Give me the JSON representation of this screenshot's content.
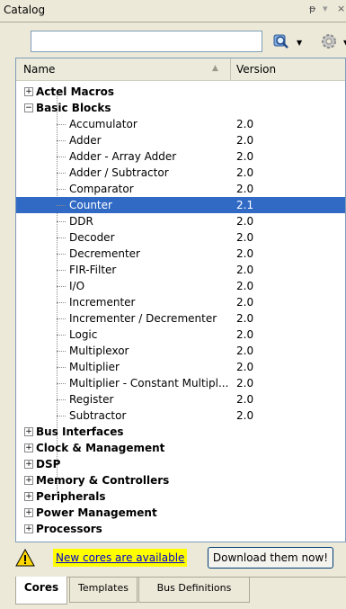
{
  "window": {
    "title": "Catalog",
    "pin_glyph": "ᵽ",
    "menu_glyph": "▾",
    "close_glyph": "×"
  },
  "search": {
    "value": "",
    "placeholder": ""
  },
  "columns": {
    "name": "Name",
    "version": "Version"
  },
  "categories_before": [
    {
      "label": "Actel Macros",
      "expanded": false
    }
  ],
  "basic_blocks": {
    "label": "Basic Blocks",
    "expanded": true,
    "items": [
      {
        "name": "Accumulator",
        "version": "2.0"
      },
      {
        "name": "Adder",
        "version": "2.0"
      },
      {
        "name": "Adder - Array Adder",
        "version": "2.0"
      },
      {
        "name": "Adder / Subtractor",
        "version": "2.0"
      },
      {
        "name": "Comparator",
        "version": "2.0"
      },
      {
        "name": "Counter",
        "version": "2.1",
        "selected": true
      },
      {
        "name": "DDR",
        "version": "2.0"
      },
      {
        "name": "Decoder",
        "version": "2.0"
      },
      {
        "name": "Decrementer",
        "version": "2.0"
      },
      {
        "name": "FIR-Filter",
        "version": "2.0"
      },
      {
        "name": "I/O",
        "version": "2.0"
      },
      {
        "name": "Incrementer",
        "version": "2.0"
      },
      {
        "name": "Incrementer / Decrementer",
        "version": "2.0"
      },
      {
        "name": "Logic",
        "version": "2.0"
      },
      {
        "name": "Multiplexor",
        "version": "2.0"
      },
      {
        "name": "Multiplier",
        "version": "2.0"
      },
      {
        "name": "Multiplier - Constant Multipl...",
        "version": "2.0"
      },
      {
        "name": "Register",
        "version": "2.0"
      },
      {
        "name": "Subtractor",
        "version": "2.0"
      }
    ]
  },
  "categories_after": [
    {
      "label": "Bus Interfaces"
    },
    {
      "label": "Clock & Management"
    },
    {
      "label": "DSP"
    },
    {
      "label": "Memory & Controllers"
    },
    {
      "label": "Peripherals"
    },
    {
      "label": "Power Management"
    },
    {
      "label": "Processors"
    }
  ],
  "notification": {
    "link_text": "New cores are available",
    "button_label": "Download them now!"
  },
  "tabs": [
    {
      "label": "Cores",
      "active": true
    },
    {
      "label": "Templates",
      "active": false
    },
    {
      "label": "Bus Definitions",
      "active": false
    }
  ],
  "colors": {
    "selection": "#316ac5",
    "link": "#0000cc",
    "highlight": "#ffff00"
  }
}
